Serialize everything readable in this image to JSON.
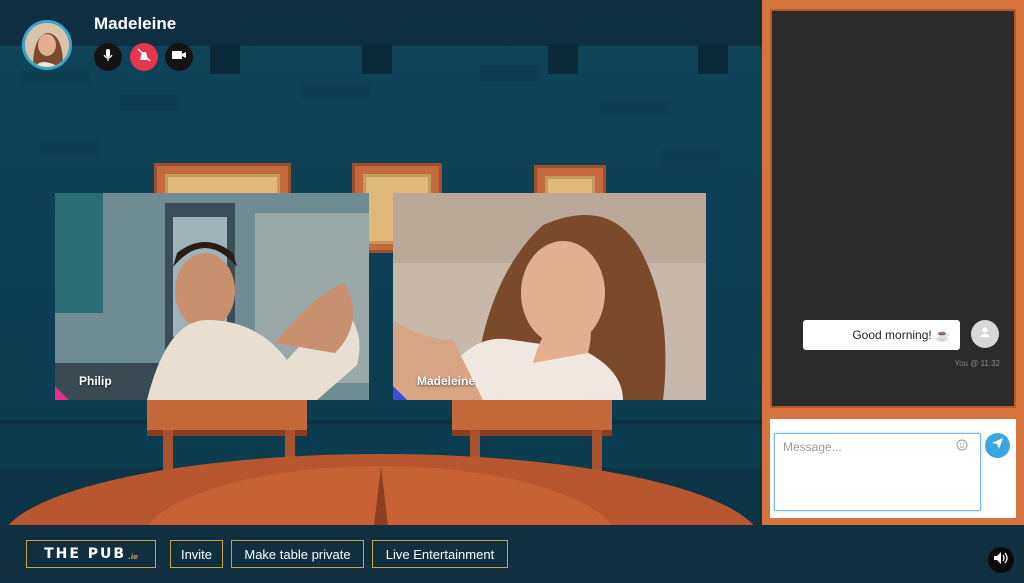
{
  "header": {
    "username": "Madeleine",
    "controls": [
      {
        "icon": "microphone-icon"
      },
      {
        "icon": "speaker-muted-icon",
        "color": "#e5364f"
      },
      {
        "icon": "camera-icon"
      }
    ]
  },
  "videos": [
    {
      "name": "Philip",
      "accent": "#e52f8a"
    },
    {
      "name": "Madeleine",
      "accent": "#3b4cd9"
    }
  ],
  "chat": {
    "messages": [
      {
        "text": "Good morning! ☕",
        "meta": "You @ 11:32"
      }
    ],
    "input_placeholder": "Message...",
    "emoji_icon": "smiley-icon",
    "send_icon": "paper-plane-icon"
  },
  "bottombar": {
    "logo_main": "THE PUB",
    "logo_suffix": ".ie",
    "buttons": [
      "Invite",
      "Make table private",
      "Live Entertainment"
    ],
    "volume_icon": "speaker-icon"
  },
  "colors": {
    "wall": "#0f4458",
    "wood": "#c86235",
    "accent_gold": "#c9a24a",
    "send_blue": "#3aa6e0"
  }
}
